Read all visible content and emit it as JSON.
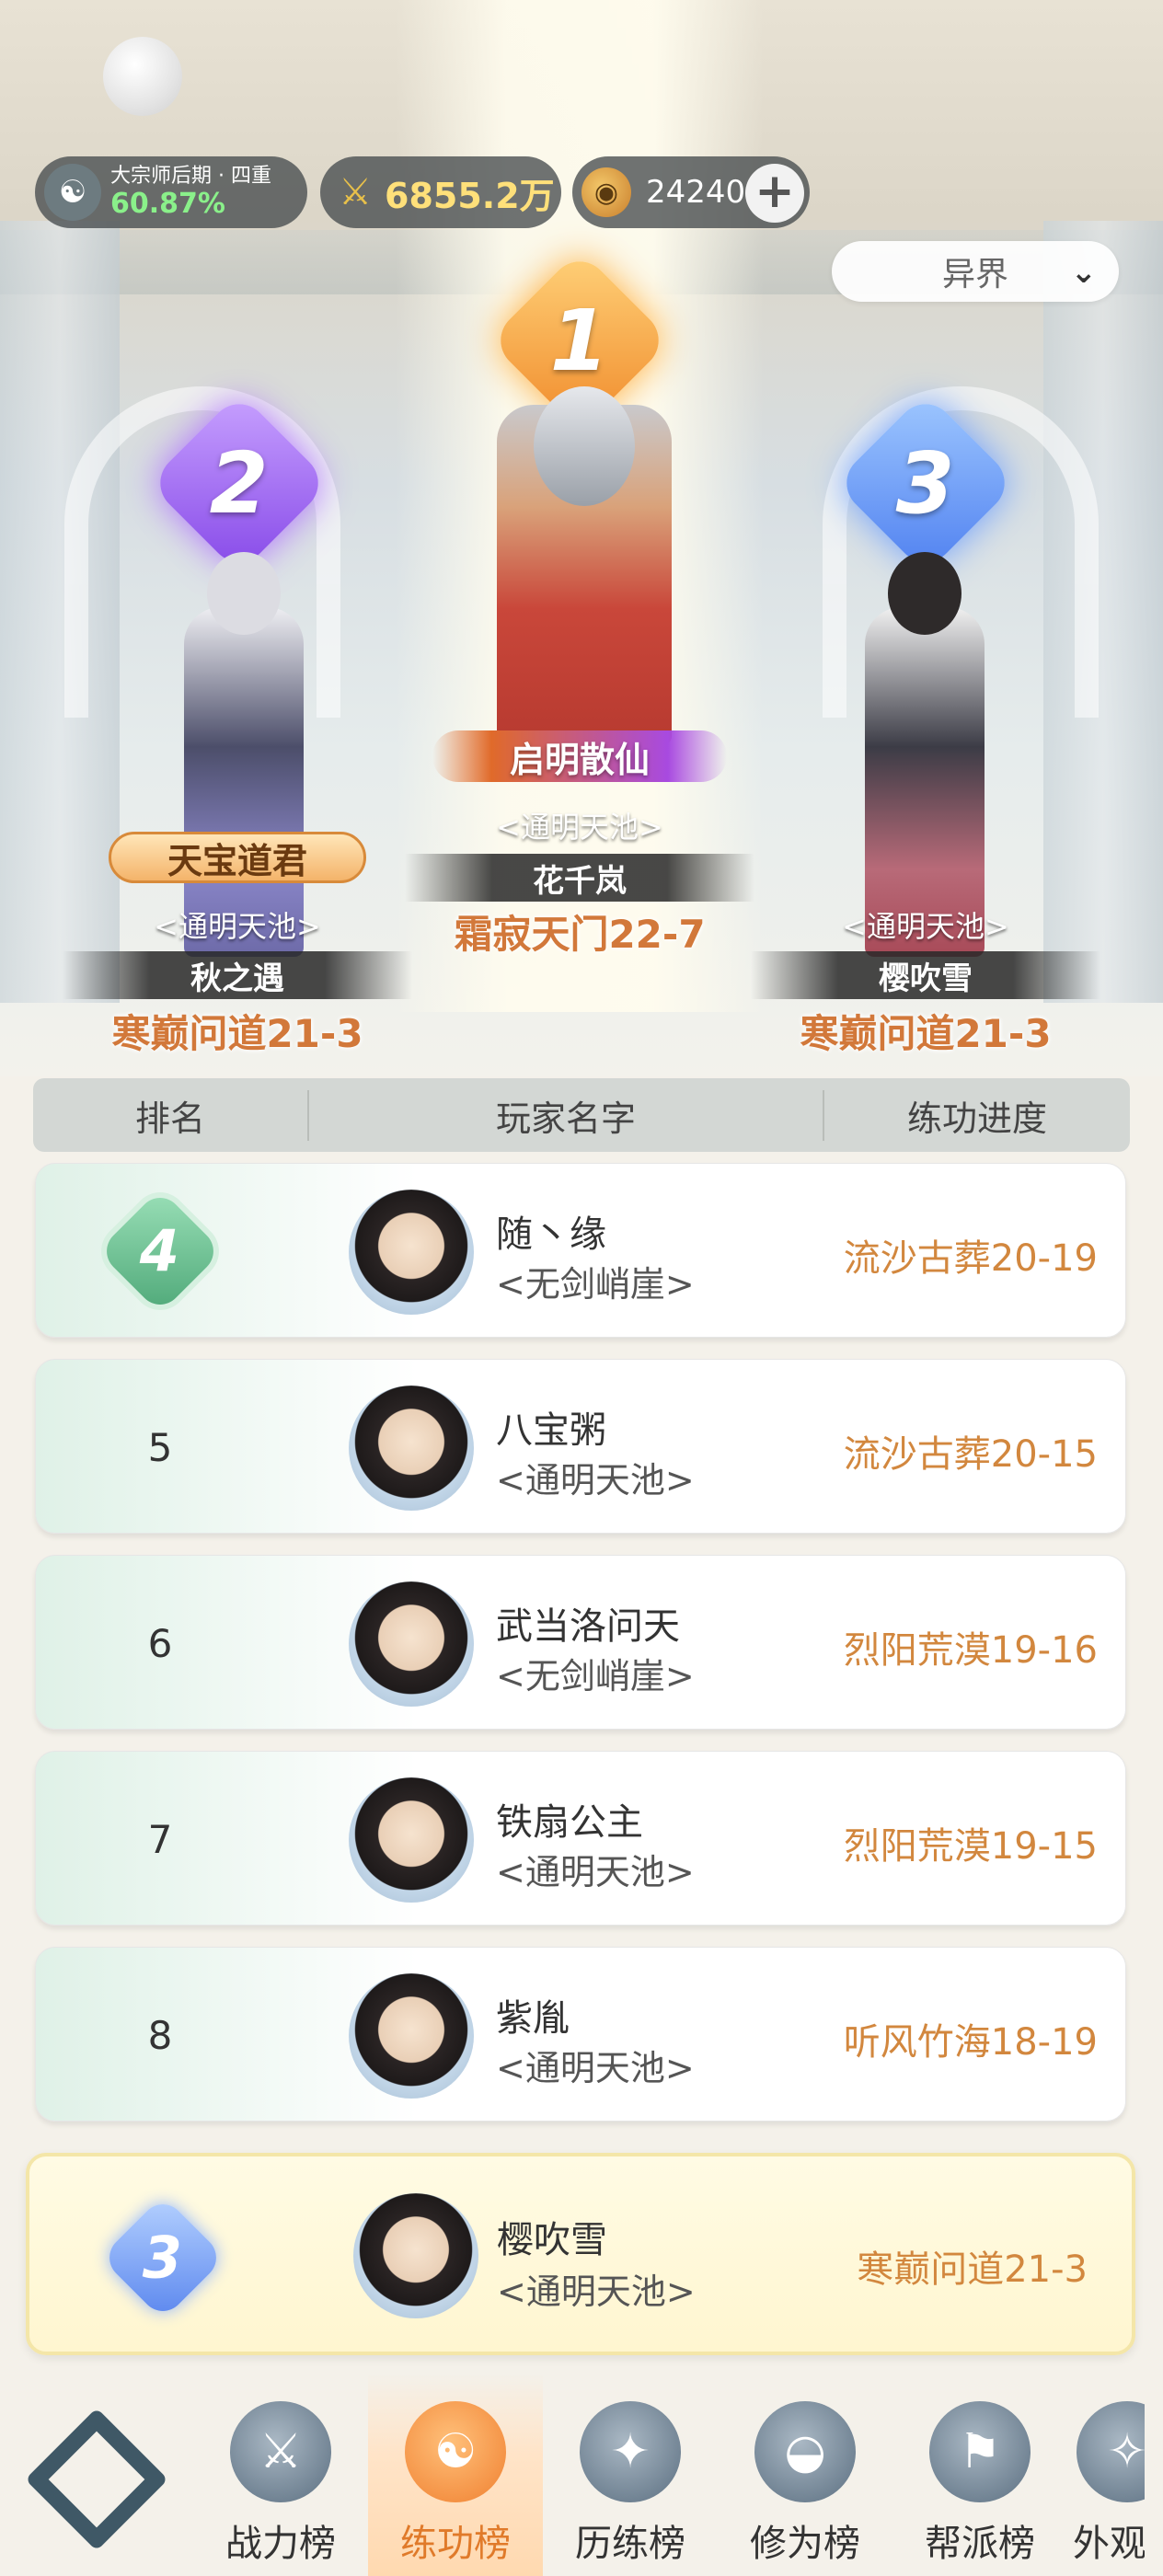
{
  "header": {
    "rank_title": "大宗师后期 · 四重",
    "rank_progress": "60.87%",
    "power": "6855.2万",
    "coins": "24240",
    "plus_label": "+",
    "realm_select": "异界"
  },
  "podium": [
    {
      "place": "1",
      "title": "启明散仙",
      "guild": "<通明天池>",
      "name": "花千岚",
      "stage": "霜寂天门22-7"
    },
    {
      "place": "2",
      "title": "天宝道君",
      "guild": "<通明天池>",
      "name": "秋之遇",
      "stage": "寒巅问道21-3"
    },
    {
      "place": "3",
      "title": "",
      "guild": "<通明天池>",
      "name": "樱吹雪",
      "stage": "寒巅问道21-3"
    }
  ],
  "table": {
    "headers": [
      "排名",
      "玩家名字",
      "练功进度"
    ],
    "rows": [
      {
        "rank": "4",
        "name": "随丶缘",
        "guild": "<无剑峭崖>",
        "stage": "流沙古葬20-19"
      },
      {
        "rank": "5",
        "name": "八宝粥",
        "guild": "<通明天池>",
        "stage": "流沙古葬20-15"
      },
      {
        "rank": "6",
        "name": "武当洛问天",
        "guild": "<无剑峭崖>",
        "stage": "烈阳荒漠19-16"
      },
      {
        "rank": "7",
        "name": "铁扇公主",
        "guild": "<通明天池>",
        "stage": "烈阳荒漠19-15"
      },
      {
        "rank": "8",
        "name": "紫胤",
        "guild": "<通明天池>",
        "stage": "听风竹海18-19"
      }
    ]
  },
  "mine": {
    "rank": "3",
    "name": "樱吹雪",
    "guild": "<通明天池>",
    "stage": "寒巅问道21-3"
  },
  "nav": [
    {
      "label": "",
      "icon": "menu-logo-icon"
    },
    {
      "label": "战力榜",
      "icon": "swords-icon"
    },
    {
      "label": "练功榜",
      "icon": "yin-yang-icon"
    },
    {
      "label": "历练榜",
      "icon": "star-icon"
    },
    {
      "label": "修为榜",
      "icon": "hat-icon"
    },
    {
      "label": "帮派榜",
      "icon": "banner-icon"
    },
    {
      "label": "外观",
      "icon": "robe-icon"
    }
  ]
}
